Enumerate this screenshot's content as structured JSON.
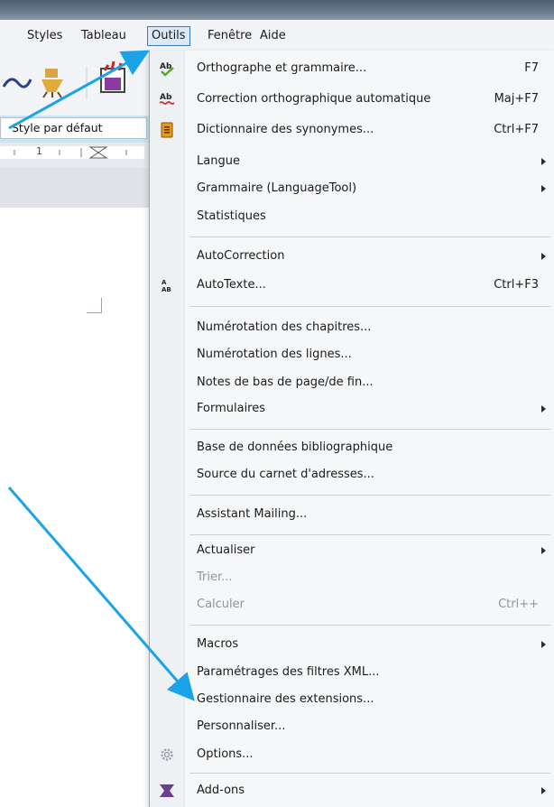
{
  "menubar": {
    "items": [
      {
        "id": "styles",
        "label": "Styles"
      },
      {
        "id": "tableau",
        "label": "Tableau"
      },
      {
        "id": "outils",
        "label": "Outils"
      },
      {
        "id": "fenetre",
        "label": "Fenêtre"
      },
      {
        "id": "aide",
        "label": "Aide"
      }
    ]
  },
  "toolbar": {
    "style_box": "Style par défaut",
    "ruler_mark": "1"
  },
  "menu": {
    "items": [
      {
        "label": "Orthographe et grammaire...",
        "shortcut": "F7",
        "icon": "spellcheck-icon"
      },
      {
        "label": "Correction orthographique automatique",
        "shortcut": "Maj+F7",
        "icon": "autospell-icon"
      },
      {
        "label": "Dictionnaire des synonymes...",
        "shortcut": "Ctrl+F7",
        "icon": "thesaurus-icon"
      },
      {
        "label": "Langue",
        "submenu": true
      },
      {
        "label": "Grammaire (LanguageTool)",
        "submenu": true
      },
      {
        "label": "Statistiques"
      },
      {
        "label": "AutoCorrection",
        "submenu": true
      },
      {
        "label": "AutoTexte...",
        "shortcut": "Ctrl+F3",
        "icon": "autotext-icon"
      },
      {
        "label": "Numérotation des chapitres..."
      },
      {
        "label": "Numérotation des lignes..."
      },
      {
        "label": "Notes de bas de page/de fin..."
      },
      {
        "label": "Formulaires",
        "submenu": true
      },
      {
        "label": "Base de données bibliographique"
      },
      {
        "label": "Source du carnet d'adresses..."
      },
      {
        "label": "Assistant Mailing..."
      },
      {
        "label": "Actualiser",
        "submenu": true
      },
      {
        "label": "Trier...",
        "disabled": true
      },
      {
        "label": "Calculer",
        "shortcut": "Ctrl++",
        "disabled": true
      },
      {
        "label": "Macros",
        "submenu": true
      },
      {
        "label": "Paramétrages des filtres XML..."
      },
      {
        "label": "Gestionnaire des extensions..."
      },
      {
        "label": "Personnaliser..."
      },
      {
        "label": "Options...",
        "icon": "gear-icon"
      },
      {
        "label": "Add-ons",
        "submenu": true,
        "icon": "addons-icon"
      }
    ]
  },
  "colors": {
    "accent_arrow": "#1aa3e8",
    "menu_bg": "#f5f7f9",
    "active_menu_border": "#3d7bbf"
  }
}
